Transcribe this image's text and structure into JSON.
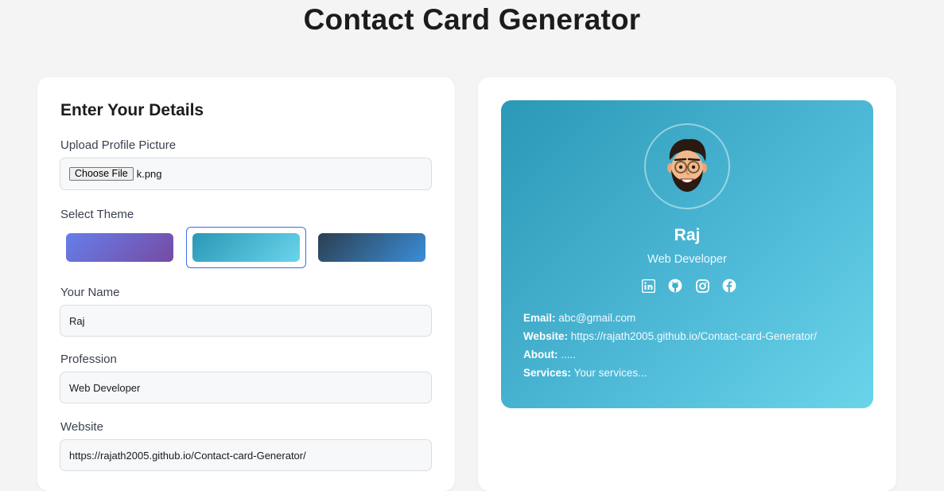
{
  "page": {
    "title": "Contact Card Generator"
  },
  "form": {
    "heading": "Enter Your Details",
    "upload": {
      "label": "Upload Profile Picture",
      "button_label": "Choose File",
      "file_name": "k.png"
    },
    "theme": {
      "label": "Select Theme",
      "options": [
        {
          "name": "purple",
          "from": "#667eea",
          "to": "#764ba2"
        },
        {
          "name": "teal",
          "from": "#2a98b6",
          "to": "#6ad4ea",
          "selected": true
        },
        {
          "name": "navy",
          "from": "#2c3e50",
          "to": "#3a8ed8"
        }
      ]
    },
    "name": {
      "label": "Your Name",
      "value": "Raj"
    },
    "profession": {
      "label": "Profession",
      "value": "Web Developer"
    },
    "website": {
      "label": "Website",
      "value": "https://rajath2005.github.io/Contact-card-Generator/"
    }
  },
  "card": {
    "name": "Raj",
    "profession": "Web Developer",
    "social_icons": [
      "linkedin-icon",
      "github-icon",
      "instagram-icon",
      "facebook-icon"
    ],
    "email_label": "Email:",
    "email": "abc@gmail.com",
    "website_label": "Website:",
    "website": "https://rajath2005.github.io/Contact-card-Generator/",
    "about_label": "About:",
    "about": ".....",
    "services_label": "Services:",
    "services": "Your services..."
  },
  "colors": {
    "card_from": "#2a98b6",
    "card_to": "#6ad4ea",
    "selected_theme_border": "#3a6fd8"
  }
}
